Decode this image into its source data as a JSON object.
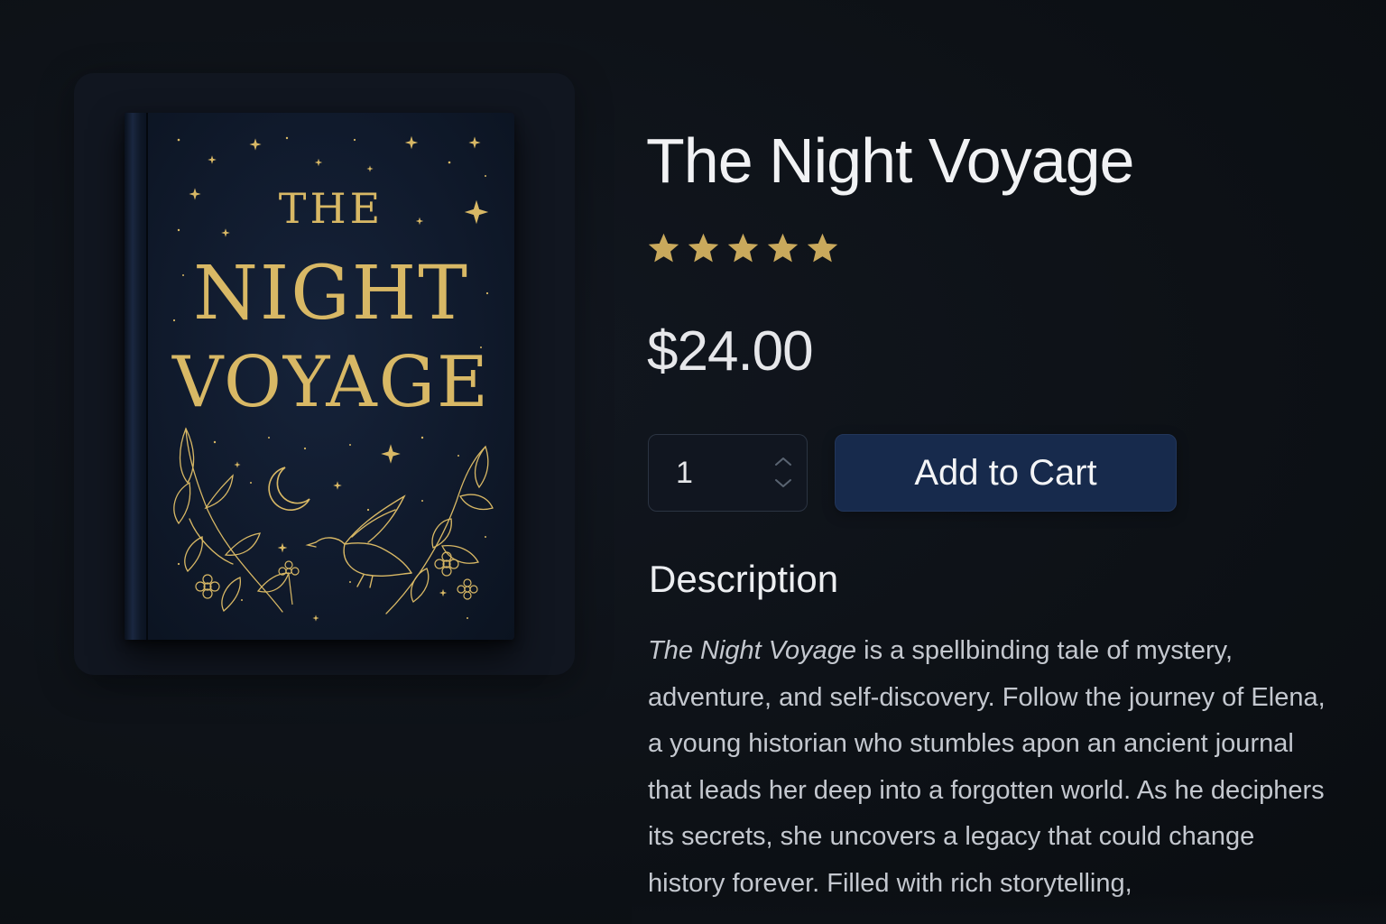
{
  "product": {
    "title": "The Night Voyage",
    "rating": 5,
    "rating_max": 5,
    "price": "$24.00",
    "quantity": "1"
  },
  "cover": {
    "line1": "THE",
    "line2": "NIGHT",
    "line3": "VOYAGE"
  },
  "actions": {
    "add_to_cart_label": "Add to Cart"
  },
  "description": {
    "heading": "Description",
    "book_title_italic": "The Night Voyage",
    "text": " is a spellbinding tale of mystery, adventure, and self-discovery. Follow the journey of Elena, a young historian who stumbles apon an ancient journal that leads her deep into a forgotten world. As he deciphers its secrets, she uncovers a legacy that could change history forever. Filled with rich storytelling,"
  },
  "colors": {
    "background": "#0d1116",
    "accent_gold": "#d8b865",
    "star_color": "#c9a95c",
    "button_bg": "#172a4c",
    "cover_navy": "#101a2c"
  },
  "icons": {
    "rating": "star-icon",
    "qty_up": "chevron-up-icon",
    "qty_down": "chevron-down-icon"
  }
}
